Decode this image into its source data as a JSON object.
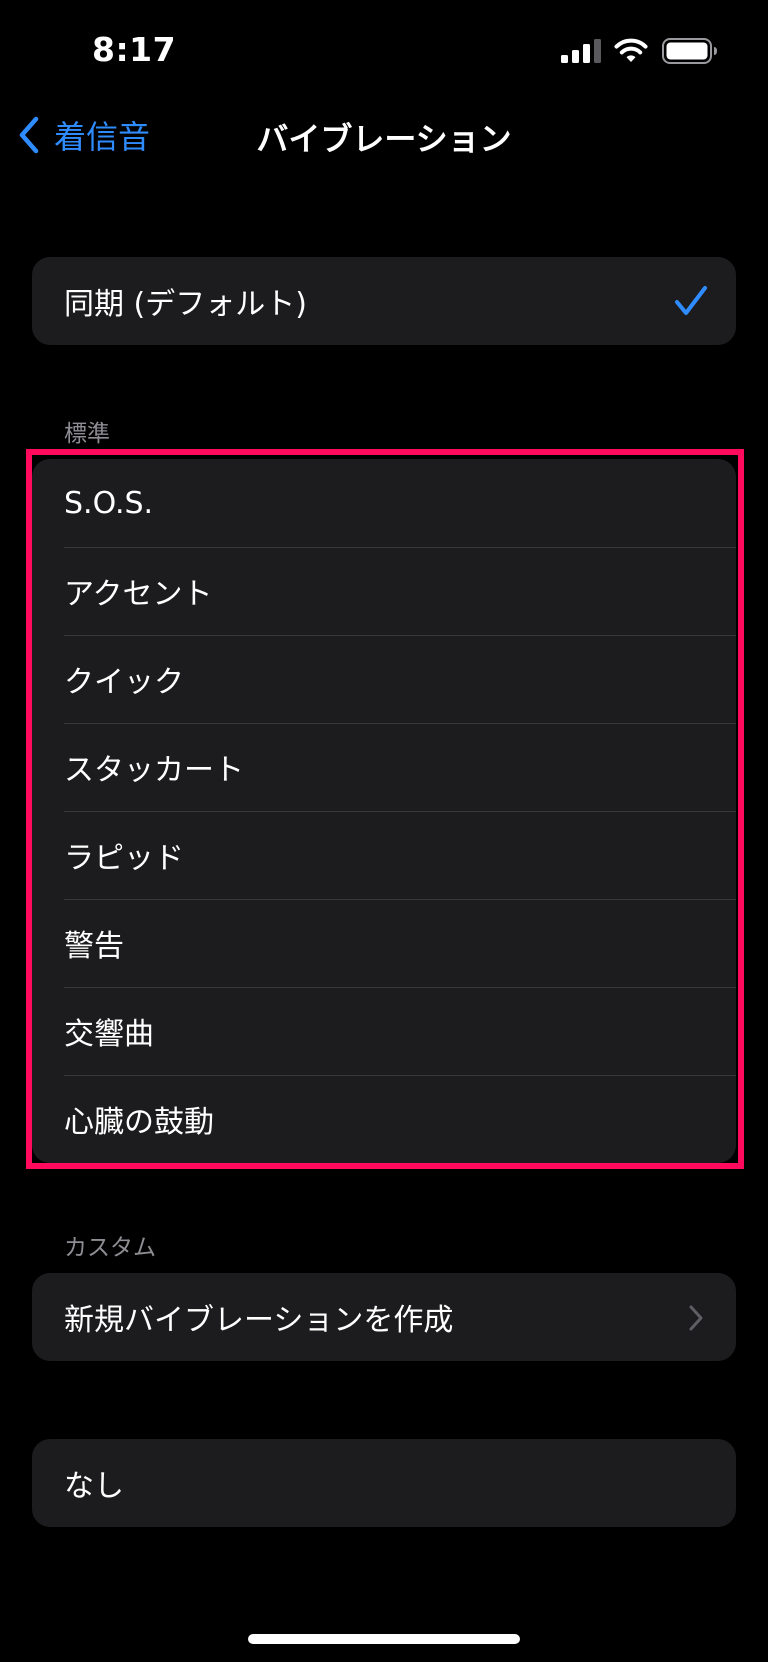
{
  "status_bar": {
    "time": "8:17"
  },
  "nav": {
    "back_label": "着信音",
    "title": "バイブレーション"
  },
  "default_section": {
    "items": [
      {
        "label": "同期 (デフォルト)",
        "selected": true
      }
    ]
  },
  "standard_section": {
    "header": "標準",
    "items": [
      {
        "label": "S.O.S."
      },
      {
        "label": "アクセント"
      },
      {
        "label": "クイック"
      },
      {
        "label": "スタッカート"
      },
      {
        "label": "ラピッド"
      },
      {
        "label": "警告"
      },
      {
        "label": "交響曲"
      },
      {
        "label": "心臓の鼓動"
      }
    ]
  },
  "custom_section": {
    "header": "カスタム",
    "items": [
      {
        "label": "新規バイブレーションを作成"
      }
    ]
  },
  "none_section": {
    "items": [
      {
        "label": "なし"
      }
    ]
  },
  "colors": {
    "background": "#000000",
    "cell": "#1c1c1e",
    "accent": "#2f8cff",
    "highlight": "#ff0a5c",
    "secondary_text": "#8d8d93"
  },
  "icons": {
    "back": "chevron-left-icon",
    "selected": "checkmark-icon",
    "disclosure": "chevron-right-icon",
    "signal": "cellular-signal-icon",
    "wifi": "wifi-icon",
    "battery": "battery-icon"
  }
}
